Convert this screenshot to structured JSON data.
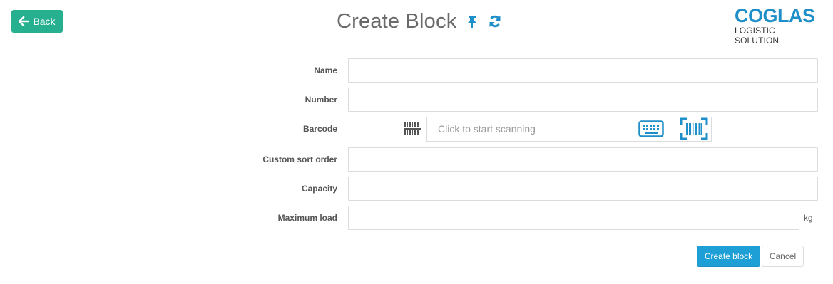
{
  "header": {
    "back_label": "Back",
    "title": "Create Block",
    "pin_icon": "pin-icon",
    "refresh_icon": "refresh-icon",
    "logo_main": "COGLAS",
    "logo_sub": "LOGISTIC SOLUTION"
  },
  "form": {
    "name": {
      "label": "Name",
      "value": ""
    },
    "number": {
      "label": "Number",
      "value": ""
    },
    "barcode": {
      "label": "Barcode",
      "placeholder": "Click to start scanning"
    },
    "custom_sort_order": {
      "label": "Custom sort order",
      "value": ""
    },
    "capacity": {
      "label": "Capacity",
      "value": ""
    },
    "maximum_load": {
      "label": "Maximum load",
      "value": "",
      "unit": "kg"
    }
  },
  "actions": {
    "create_label": "Create block",
    "cancel_label": "Cancel"
  },
  "colors": {
    "back_button": "#26b08f",
    "accent": "#1e9fd6",
    "logo": "#1e8fc8",
    "icon_blue": "#1e8fc8"
  }
}
